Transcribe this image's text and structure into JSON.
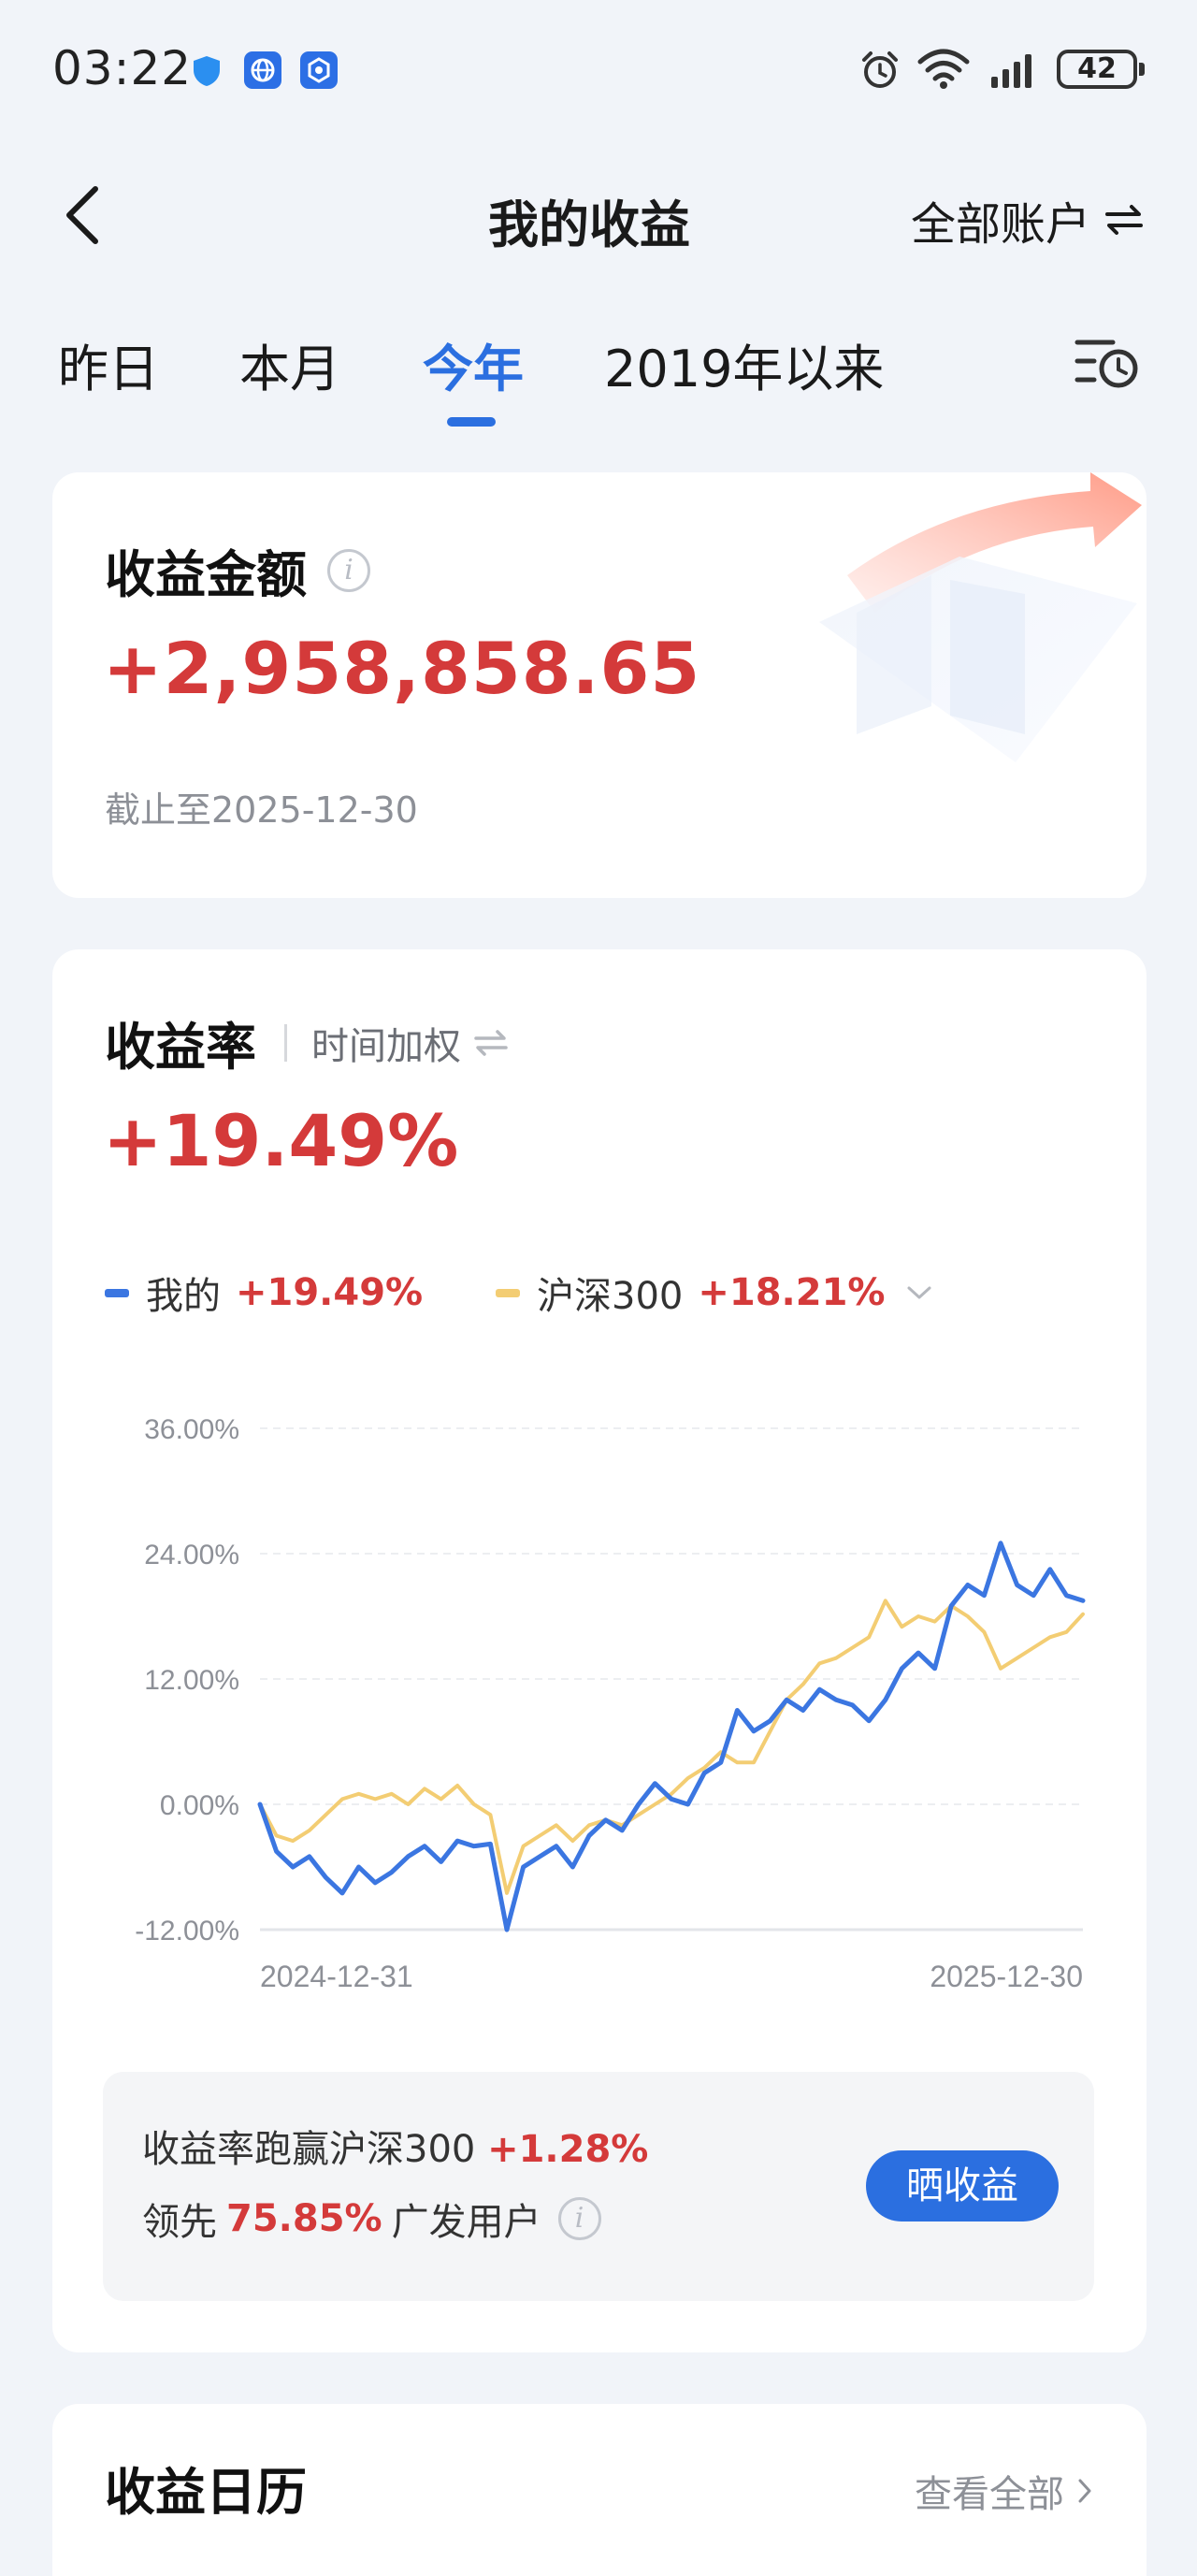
{
  "status_bar": {
    "time": "03:22",
    "battery": "42",
    "icons": [
      "shield-icon",
      "browser-icon",
      "app-icon",
      "alarm-icon",
      "wifi-icon",
      "signal-icon",
      "battery-icon"
    ]
  },
  "nav": {
    "title": "我的收益",
    "account_switch": "全部账户",
    "icons": [
      "back-arrow-icon",
      "swap-icon"
    ]
  },
  "tabs": [
    {
      "label": "昨日",
      "active": false
    },
    {
      "label": "本月",
      "active": false
    },
    {
      "label": "今年",
      "active": true
    },
    {
      "label": "2019年以来",
      "active": false
    }
  ],
  "amount_card": {
    "title": "收益金额",
    "value": "+2,958,858.65",
    "as_of": "截止至2025-12-30"
  },
  "rate_card": {
    "title": "收益率",
    "method": "时间加权",
    "value": "+19.49%",
    "legend": [
      {
        "name": "我的",
        "value": "+19.49%",
        "color": "#3b76e1"
      },
      {
        "name": "沪深300",
        "value": "+18.21%",
        "color": "#f3cd73"
      }
    ],
    "compare": {
      "line1_prefix": "收益率跑赢沪深300",
      "line1_value": "+1.28%",
      "line2_prefix": "领先",
      "line2_value": "75.85%",
      "line2_suffix": "广发用户",
      "button": "晒收益"
    }
  },
  "calendar_card": {
    "title": "收益日历",
    "view_all": "查看全部"
  },
  "colors": {
    "accent": "#2b6fe0",
    "gain": "#d43a3a",
    "background": "#f1f4f9"
  },
  "chart_data": {
    "type": "line",
    "x_start_label": "2024-12-31",
    "x_end_label": "2025-12-30",
    "ylim": [
      -12,
      36
    ],
    "y_ticks": [
      "36.00%",
      "24.00%",
      "12.00%",
      "0.00%",
      "-12.00%"
    ],
    "grid": true,
    "legend": "top-left",
    "x": [
      0,
      2,
      4,
      6,
      8,
      10,
      12,
      14,
      16,
      18,
      20,
      22,
      24,
      26,
      28,
      30,
      32,
      34,
      36,
      38,
      40,
      42,
      44,
      46,
      48,
      50,
      52,
      54,
      56,
      58,
      60,
      62,
      64,
      66,
      68,
      70,
      72,
      74,
      76,
      78,
      80,
      82,
      84,
      86,
      88,
      90,
      92,
      94,
      96,
      98,
      100
    ],
    "series": [
      {
        "name": "我的",
        "values": [
          0.0,
          -4.5,
          -6.0,
          -5.0,
          -7.0,
          -8.5,
          -6.0,
          -7.5,
          -6.5,
          -5.0,
          -4.0,
          -5.5,
          -3.5,
          -4.0,
          -3.8,
          -12.0,
          -6.0,
          -5.0,
          -4.0,
          -6.0,
          -3.0,
          -1.5,
          -2.5,
          0.0,
          2.0,
          0.5,
          0.0,
          3.0,
          4.0,
          9.0,
          7.0,
          8.0,
          10.0,
          9.0,
          11.0,
          10.0,
          9.5,
          8.0,
          10.0,
          13.0,
          14.5,
          13.0,
          19.0,
          21.0,
          20.0,
          25.0,
          21.0,
          20.0,
          22.5,
          20.0,
          19.5
        ],
        "color": "#3b76e1"
      },
      {
        "name": "沪深300",
        "values": [
          0.0,
          -3.0,
          -3.5,
          -2.5,
          -1.0,
          0.5,
          1.0,
          0.5,
          1.0,
          0.0,
          1.5,
          0.5,
          1.8,
          0.0,
          -1.0,
          -8.5,
          -4.0,
          -3.0,
          -2.0,
          -3.5,
          -2.0,
          -1.5,
          -2.0,
          -1.0,
          0.0,
          1.0,
          2.5,
          3.5,
          5.0,
          4.0,
          4.0,
          7.0,
          10.0,
          11.5,
          13.5,
          14.0,
          15.0,
          16.0,
          19.5,
          17.0,
          18.0,
          17.5,
          19.0,
          18.0,
          16.5,
          13.0,
          14.0,
          15.0,
          16.0,
          16.5,
          18.21
        ],
        "color": "#f3cd73"
      }
    ]
  }
}
